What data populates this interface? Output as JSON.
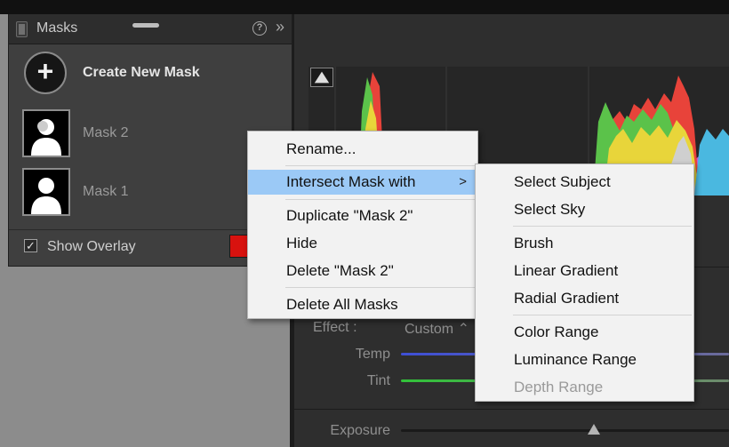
{
  "panel": {
    "title": "Masks",
    "help_icon": "?",
    "collapse_icon": "»"
  },
  "create_mask": {
    "icon": "+",
    "label": "Create New Mask"
  },
  "masks": [
    {
      "name": "Mask 2"
    },
    {
      "name": "Mask 1"
    }
  ],
  "overlay": {
    "label": "Show Overlay",
    "checked": true,
    "color": "#d8120f"
  },
  "adjustments": {
    "effect_label": "Effect :",
    "effect_value": "Custom ⌃",
    "temp_label": "Temp",
    "tint_label": "Tint",
    "exposure_label": "Exposure"
  },
  "context_menu": {
    "items": [
      {
        "label": "Rename..."
      },
      {
        "label": "Intersect Mask with",
        "has_submenu": true,
        "highlighted": true
      },
      {
        "label": "Duplicate \"Mask 2\""
      },
      {
        "label": "Hide"
      },
      {
        "label": "Delete \"Mask 2\""
      },
      {
        "label": "Delete All Masks"
      }
    ],
    "submenu_arrow": ">"
  },
  "submenu": {
    "items": [
      {
        "label": "Select Subject"
      },
      {
        "label": "Select Sky"
      },
      {
        "label": "Brush"
      },
      {
        "label": "Linear Gradient"
      },
      {
        "label": "Radial Gradient"
      },
      {
        "label": "Color Range"
      },
      {
        "label": "Luminance Range"
      },
      {
        "label": "Depth Range",
        "disabled": true
      }
    ]
  },
  "colors": {
    "menu_highlight": "#9bc9f6",
    "panel_bg": "#3f3f3f",
    "overlay_swatch": "#d8120f"
  }
}
